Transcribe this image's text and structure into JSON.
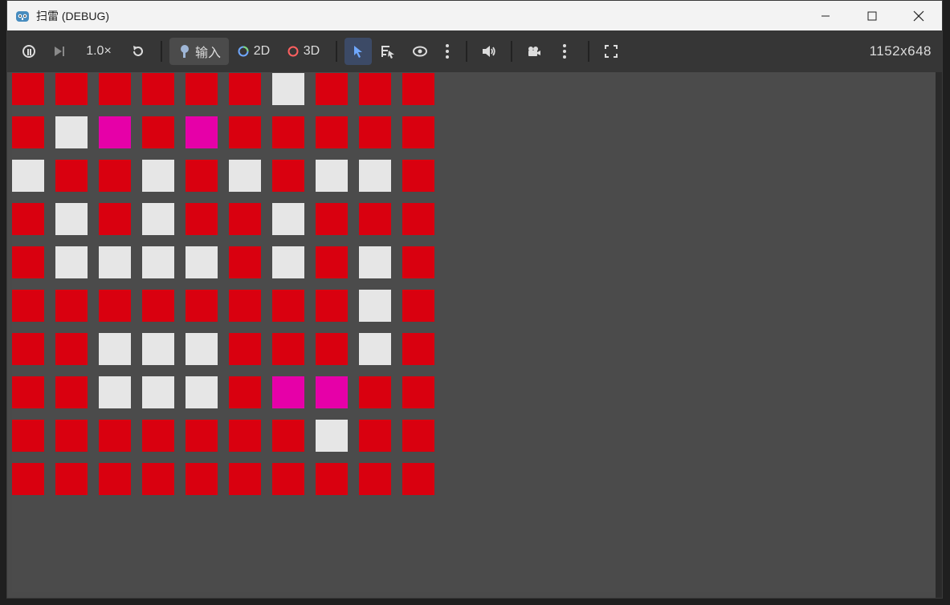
{
  "window": {
    "title": "扫雷 (DEBUG)"
  },
  "toolbar": {
    "speed": "1.0×",
    "input_label": "输入",
    "mode_2d": "2D",
    "mode_3d": "3D",
    "resolution": "1152x648"
  },
  "colors": {
    "red": "#d9000f",
    "white": "#e6e6e6",
    "magenta": "#e600a8",
    "viewport_bg": "#4b4b4b",
    "toolbar_bg": "#363636"
  },
  "board": {
    "rows": [
      [
        "R",
        "R",
        "R",
        "R",
        "R",
        "R",
        "W",
        "R",
        "R",
        "R"
      ],
      [
        "R",
        "W",
        "M",
        "R",
        "M",
        "R",
        "R",
        "R",
        "R",
        "R"
      ],
      [
        "W",
        "R",
        "R",
        "W",
        "R",
        "W",
        "R",
        "W",
        "W",
        "R"
      ],
      [
        "R",
        "W",
        "R",
        "W",
        "R",
        "R",
        "W",
        "R",
        "R",
        "R"
      ],
      [
        "R",
        "W",
        "W",
        "W",
        "W",
        "R",
        "W",
        "R",
        "W",
        "R"
      ],
      [
        "R",
        "R",
        "R",
        "R",
        "R",
        "R",
        "R",
        "R",
        "W",
        "R"
      ],
      [
        "R",
        "R",
        "W",
        "W",
        "W",
        "R",
        "R",
        "R",
        "W",
        "R"
      ],
      [
        "R",
        "R",
        "W",
        "W",
        "W",
        "R",
        "M",
        "M",
        "R",
        "R"
      ],
      [
        "R",
        "R",
        "R",
        "R",
        "R",
        "R",
        "R",
        "W",
        "R",
        "R"
      ],
      [
        "R",
        "R",
        "R",
        "R",
        "R",
        "R",
        "R",
        "R",
        "R",
        "R"
      ]
    ]
  }
}
